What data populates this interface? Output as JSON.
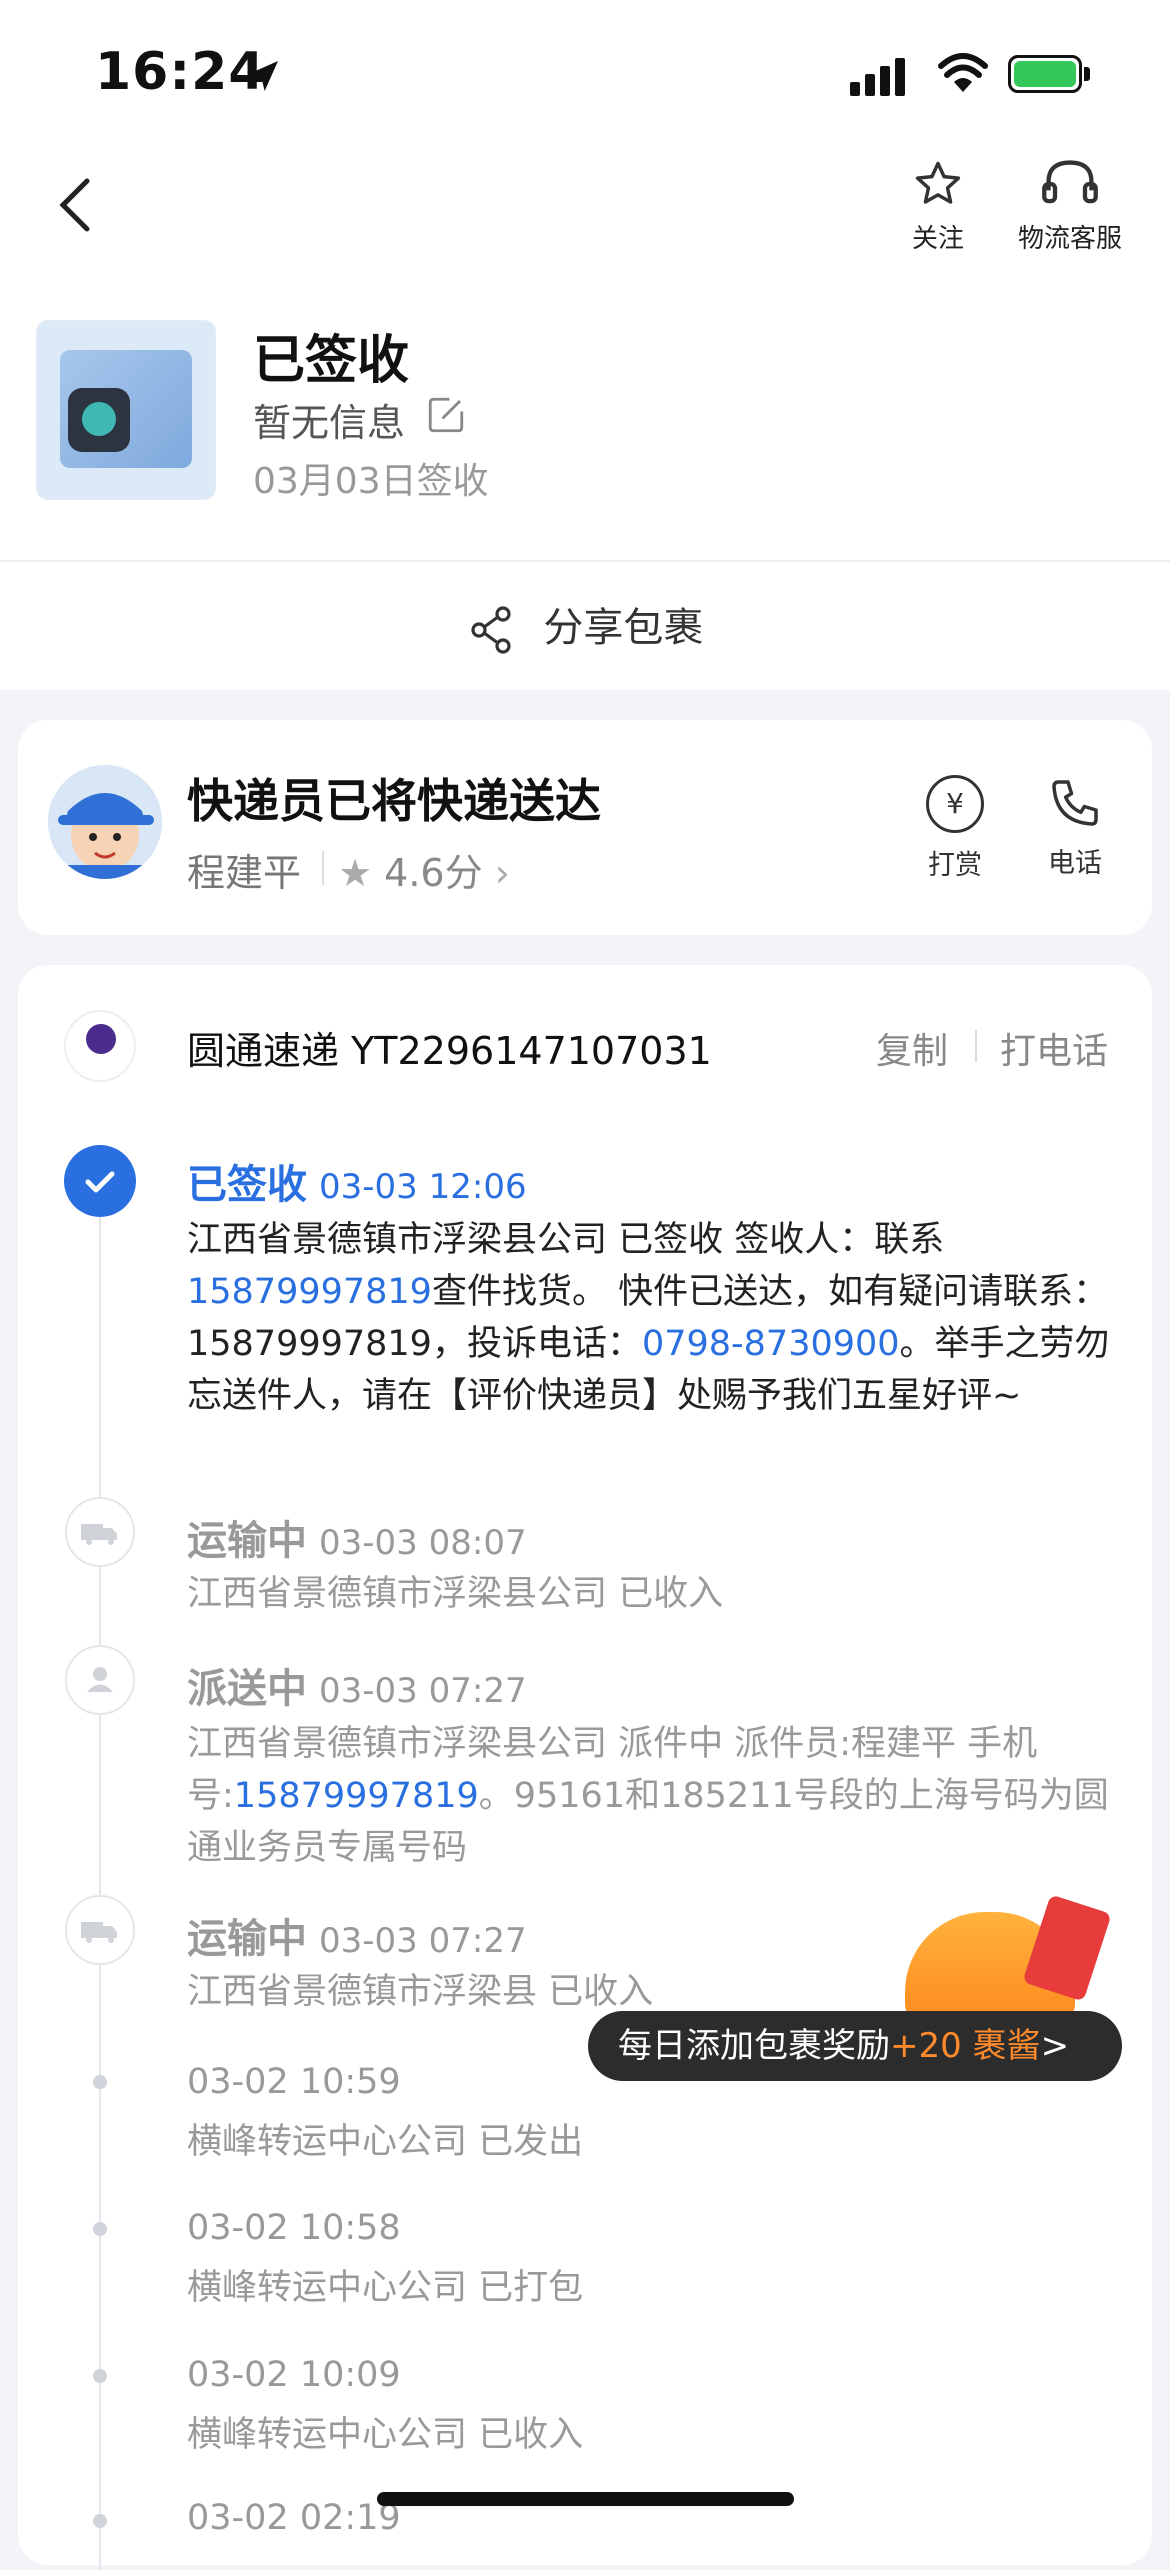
{
  "status_bar": {
    "time": "16:24"
  },
  "nav": {
    "follow_label": "关注",
    "service_label": "物流客服"
  },
  "package": {
    "status": "已签收",
    "info": "暂无信息",
    "date": "03月03日签收"
  },
  "share_label": "分享包裹",
  "courier": {
    "title": "快递员已将快递送达",
    "name": "程建平",
    "rating": "4.6分",
    "tip_label": "打赏",
    "phone_label": "电话"
  },
  "tracking": {
    "carrier_line": "圆通速递 YT2296147107031",
    "copy_label": "复制",
    "call_label": "打电话",
    "events": [
      {
        "title": "已签收",
        "time": "03-03 12:06",
        "body_a": "江西省景德镇市浮梁县公司 已签收 签收人：联系",
        "phone1": "15879997819",
        "body_b": "查件找货。 快件已送达，如有疑问请联系：15879997819，投诉电话：",
        "phone2": "0798-8730900",
        "body_c": "。举手之劳勿忘送件人，请在【评价快递员】处赐予我们五星好评~"
      },
      {
        "title": "运输中",
        "time": "03-03 08:07",
        "body": "江西省景德镇市浮梁县公司 已收入"
      },
      {
        "title": "派送中",
        "time": "03-03 07:27",
        "body_a": "江西省景德镇市浮梁县公司 派件中 派件员:程建平 手机号:",
        "phone": "15879997819",
        "body_b": "。95161和185211号段的上海号码为圆通业务员专属号码"
      },
      {
        "title": "运输中",
        "time": "03-03 07:27",
        "body": "江西省景德镇市浮梁县 已收入"
      },
      {
        "time": "03-02 10:59",
        "body": "横峰转运中心公司 已发出"
      },
      {
        "time": "03-02 10:58",
        "body": "横峰转运中心公司 已打包"
      },
      {
        "time": "03-02 10:09",
        "body": "横峰转运中心公司 已收入"
      },
      {
        "time": "03-02 02:19"
      }
    ]
  },
  "reward": {
    "text": "每日添加包裹奖励",
    "highlight": "+20 裹酱",
    "arrow": ">"
  },
  "colors": {
    "accent": "#2a6fe0",
    "reward_orange": "#ff8a2b"
  }
}
